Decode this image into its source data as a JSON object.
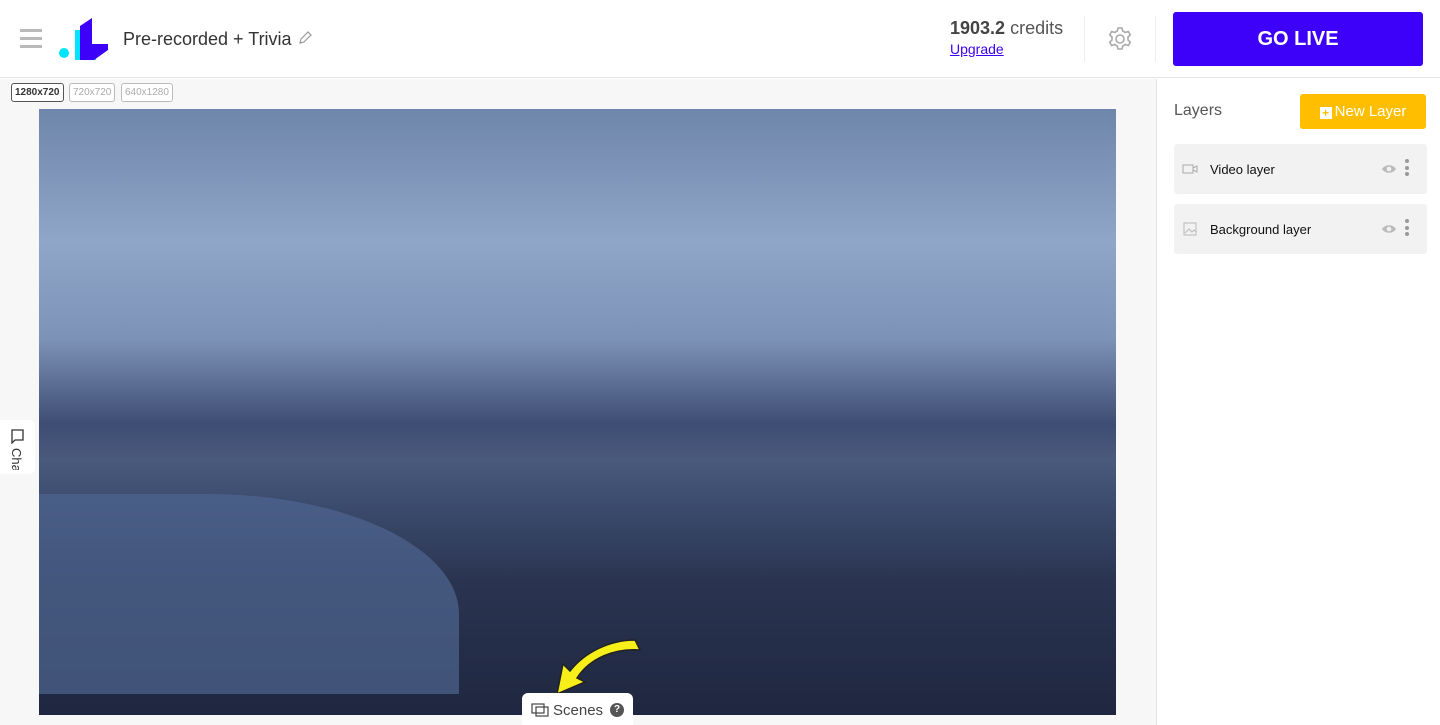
{
  "header": {
    "title": "Pre-recorded + Trivia",
    "credits_value": "1903.2",
    "credits_unit": "credits",
    "upgrade_label": "Upgrade",
    "go_live_label": "GO LIVE"
  },
  "canvas": {
    "resolutions": [
      "1280x720",
      "720x720",
      "640x1280"
    ],
    "selected_resolution": "1280x720"
  },
  "chat_tab": {
    "label": "Chat"
  },
  "scenes": {
    "label": "Scenes",
    "help": "?"
  },
  "layers": {
    "title": "Layers",
    "new_layer_label": "New Layer",
    "items": [
      {
        "label": "Video layer",
        "icon": "video-camera-icon"
      },
      {
        "label": "Background layer",
        "icon": "image-icon"
      }
    ]
  },
  "colors": {
    "brand": "#3d00f8",
    "accent": "#ffbf00",
    "logo_cyan": "#00e5ff"
  }
}
